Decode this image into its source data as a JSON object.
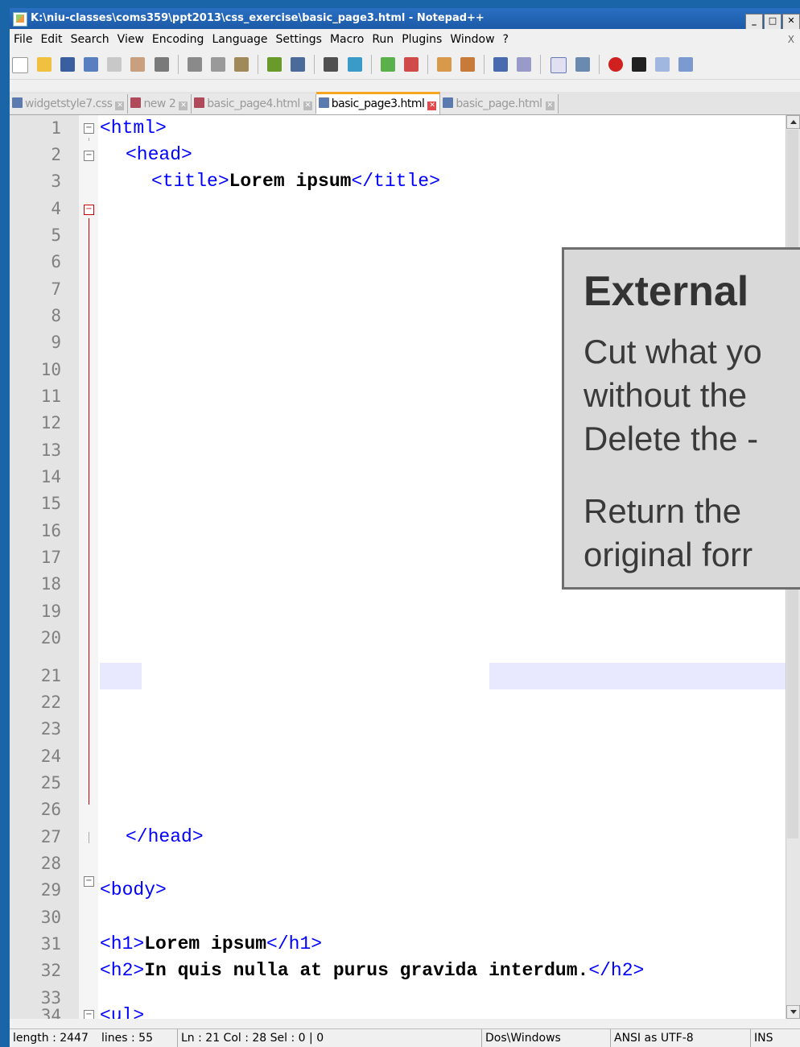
{
  "window": {
    "title": "K:\\niu-classes\\coms359\\ppt2013\\css_exercise\\basic_page3.html - Notepad++",
    "controls": [
      "_",
      "□",
      "✕"
    ]
  },
  "menu": [
    "File",
    "Edit",
    "Search",
    "View",
    "Encoding",
    "Language",
    "Settings",
    "Macro",
    "Run",
    "Plugins",
    "Window",
    "?"
  ],
  "menu_close": "X",
  "tabs": [
    {
      "label": "widgetstyle7.css",
      "active": false
    },
    {
      "label": "new 2",
      "active": false
    },
    {
      "label": "basic_page4.html",
      "active": false
    },
    {
      "label": "basic_page3.html",
      "active": true
    },
    {
      "label": "basic_page.html",
      "active": false
    }
  ],
  "editor": {
    "line_numbers": [
      "1",
      "2",
      "3",
      "4",
      "5",
      "6",
      "7",
      "8",
      "9",
      "10",
      "11",
      "12",
      "13",
      "14",
      "15",
      "16",
      "17",
      "18",
      "19",
      "20",
      "21",
      "22",
      "23",
      "24",
      "25",
      "26",
      "27",
      "28",
      "29",
      "30",
      "31",
      "32",
      "33",
      "34"
    ],
    "code": {
      "l1": "<html>",
      "l2": "<head>",
      "l3_open": "<title>",
      "l3_text": "Lorem ipsum",
      "l3_close": "</title>",
      "l27": "</head>",
      "l29": "<body>",
      "l31_open": "<h1>",
      "l31_text": "Lorem ipsum",
      "l31_close": "</h1>",
      "l32_open": "<h2>",
      "l32_text": "In quis nulla at purus gravida interdum.",
      "l32_close": "</h2>",
      "l34": "<ul>"
    }
  },
  "callout": {
    "heading": "External",
    "line1": "Cut what yo",
    "line2": "without the",
    "line3": "Delete the -",
    "line4": "Return the",
    "line5": "original forr"
  },
  "status": {
    "length": "length : 2447",
    "lines": "lines : 55",
    "position": "Ln : 21   Col : 28   Sel : 0 | 0",
    "eol": "Dos\\Windows",
    "encoding": "ANSI as UTF-8",
    "mode": "INS"
  }
}
